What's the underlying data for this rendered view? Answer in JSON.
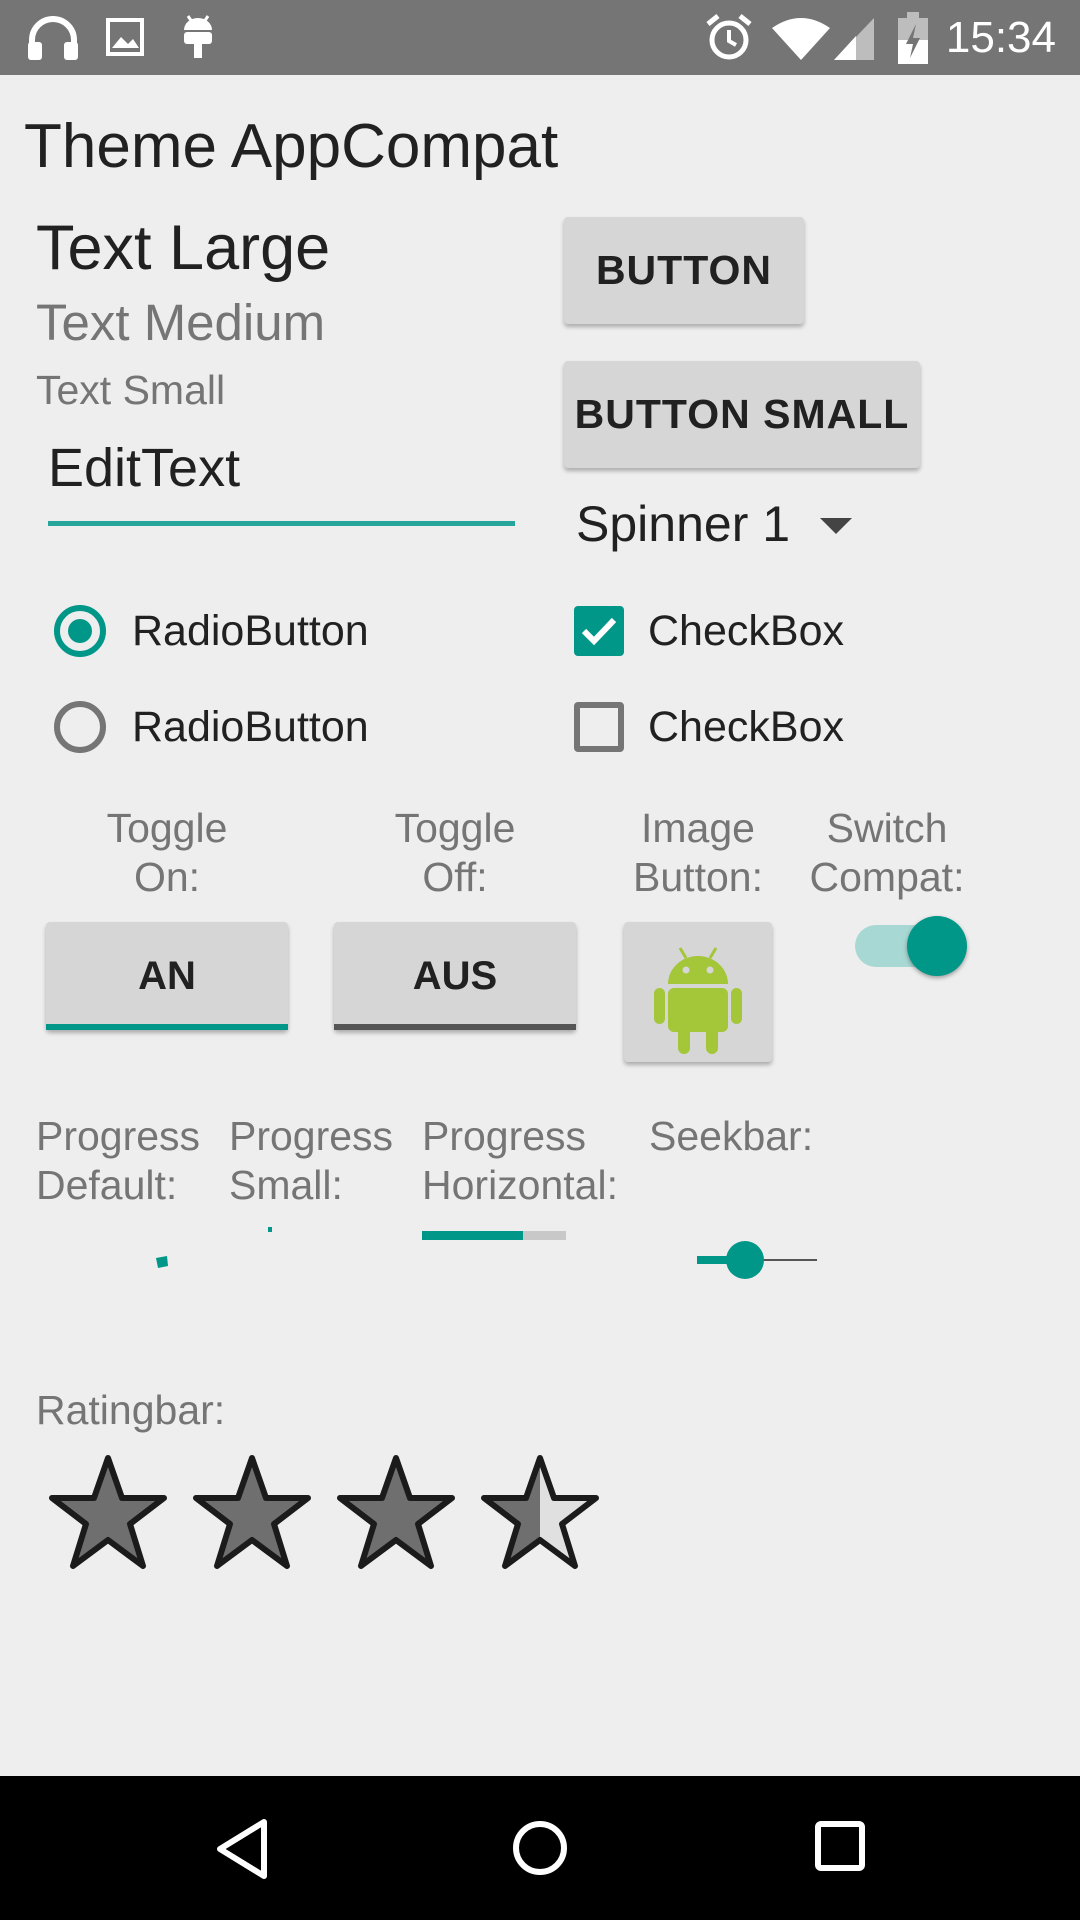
{
  "status_bar": {
    "time": "15:34",
    "left_icons": [
      "headphones-icon",
      "image-icon",
      "android-debug-icon"
    ],
    "right_icons": [
      "alarm-icon",
      "wifi-icon",
      "signal-icon",
      "battery-charging-icon"
    ]
  },
  "title": "Theme AppCompat",
  "texts": {
    "large": "Text Large",
    "medium": "Text Medium",
    "small": "Text Small"
  },
  "edit_text": {
    "value": "EditText"
  },
  "buttons": {
    "button": "BUTTON",
    "button_small": "BUTTON SMALL"
  },
  "spinner": {
    "selected": "Spinner 1"
  },
  "radios": [
    {
      "label": "RadioButton",
      "checked": true
    },
    {
      "label": "RadioButton",
      "checked": false
    }
  ],
  "checkboxes": [
    {
      "label": "CheckBox",
      "checked": true
    },
    {
      "label": "CheckBox",
      "checked": false
    }
  ],
  "toggles": {
    "on_caption_1": "Toggle",
    "on_caption_2": "On:",
    "on_label": "AN",
    "off_caption_1": "Toggle",
    "off_caption_2": "Off:",
    "off_label": "AUS"
  },
  "image_button": {
    "caption_1": "Image",
    "caption_2": "Button:",
    "icon": "android-robot-icon"
  },
  "switch": {
    "caption_1": "Switch",
    "caption_2": "Compat:",
    "checked": true
  },
  "progress": {
    "default_1": "Progress",
    "default_2": "Default:",
    "small_1": "Progress",
    "small_2": "Small:",
    "horizontal_1": "Progress",
    "horizontal_2": "Horizontal:",
    "horizontal_value": 0.7
  },
  "seekbar": {
    "caption": "Seekbar:",
    "value": 0.4
  },
  "ratingbar": {
    "caption": "Ratingbar:",
    "rating": 3.5,
    "max": 4
  },
  "colors": {
    "accent": "#009688",
    "status_bar": "#757575",
    "background": "#eeeeee"
  },
  "nav_bar": {
    "icons": [
      "back-icon",
      "home-icon",
      "recents-icon"
    ]
  }
}
